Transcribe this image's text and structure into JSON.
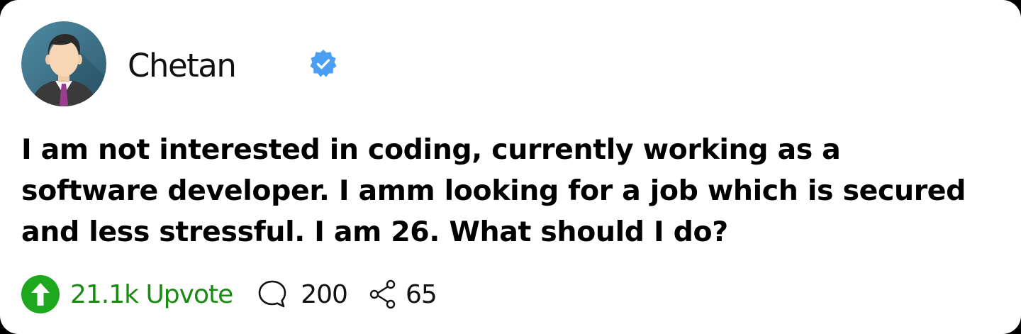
{
  "post": {
    "author": {
      "name": "Chetan",
      "verified": true,
      "verified_color": "#4a9ff5",
      "avatar_bg": "#3d6f87"
    },
    "text": "I am not interested in coding, currently working as a software developer. I amm looking for a job which is secured and less stressful. I am 26. What should I do?",
    "actions": {
      "upvote_label": "21.1k Upvote",
      "upvote_color": "#1a8a12",
      "comments": "200",
      "shares": "65"
    }
  }
}
